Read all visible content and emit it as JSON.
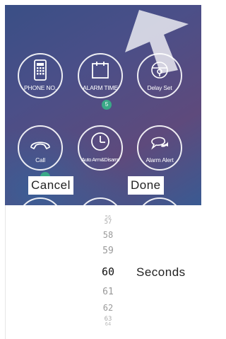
{
  "tiles": [
    {
      "label": "PHONE NO.",
      "icon": "phone-icon"
    },
    {
      "label": "ALARM TIME",
      "icon": "calendar-icon"
    },
    {
      "label": "Delay Set",
      "icon": "lock-icon"
    },
    {
      "label": "Call",
      "icon": "handset-icon"
    },
    {
      "label": "Auto Arm&Disarm",
      "icon": "clock-icon"
    },
    {
      "label": "Alarm Alert",
      "icon": "chat-icon"
    }
  ],
  "alarm_badge": "5",
  "buttons": {
    "cancel": "Cancel",
    "done": "Done"
  },
  "picker": {
    "values": [
      "56",
      "57",
      "58",
      "59",
      "60",
      "61",
      "62",
      "63",
      "64"
    ],
    "selected": "60",
    "unit": "Seconds"
  },
  "colors": {
    "badge": "#3aa987",
    "screen_bg": "#4b4f88"
  }
}
